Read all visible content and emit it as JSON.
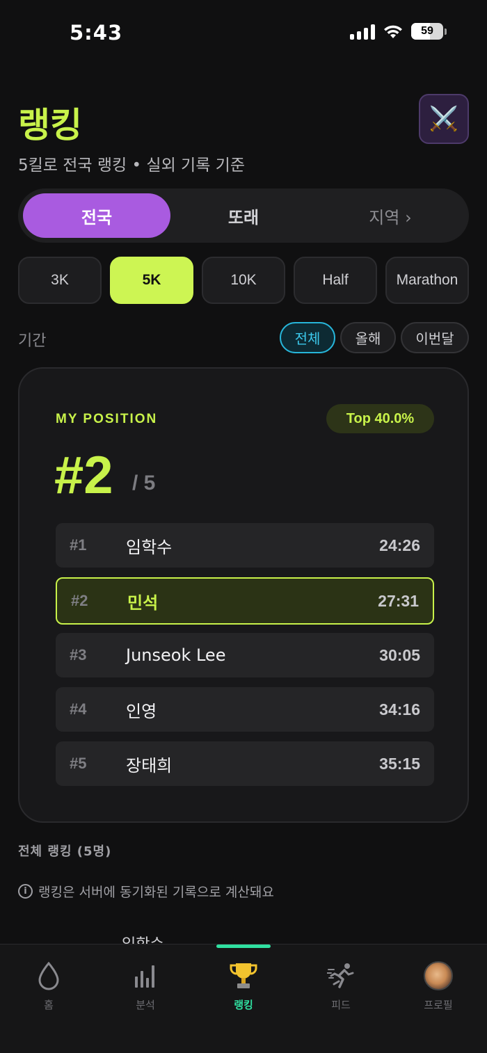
{
  "status_bar": {
    "time": "5:43",
    "battery": "59"
  },
  "header": {
    "title": "랭킹",
    "subtitle": "5킬로 전국 랭킹 • 실외 기록 기준",
    "battle_icon": "crossed-swords-icon"
  },
  "scope_tabs": [
    {
      "label": "전국",
      "active": true
    },
    {
      "label": "또래",
      "active": false
    },
    {
      "label": "지역 ›",
      "active": false
    }
  ],
  "distance_chips": [
    {
      "label": "3K",
      "active": false
    },
    {
      "label": "5K",
      "active": true
    },
    {
      "label": "10K",
      "active": false
    },
    {
      "label": "Half",
      "active": false
    },
    {
      "label": "Marathon",
      "active": false
    }
  ],
  "period": {
    "label": "기간",
    "options": [
      {
        "label": "전체",
        "active": true
      },
      {
        "label": "올해",
        "active": false
      },
      {
        "label": "이번달",
        "active": false
      }
    ]
  },
  "my_position": {
    "label": "MY POSITION",
    "top_badge": "Top 40.0%",
    "rank": "#2",
    "total": "/ 5"
  },
  "rankings": [
    {
      "rank": "#1",
      "name": "임학수",
      "time": "24:26",
      "me": false
    },
    {
      "rank": "#2",
      "name": "민석",
      "time": "27:31",
      "me": true
    },
    {
      "rank": "#3",
      "name": "Junseok Lee",
      "time": "30:05",
      "me": false
    },
    {
      "rank": "#4",
      "name": "인영",
      "time": "34:16",
      "me": false
    },
    {
      "rank": "#5",
      "name": "장태희",
      "time": "35:15",
      "me": false
    }
  ],
  "full_ranking_title": "전체 랭킹 (5명)",
  "info_text": "랭킹은 서버에 동기화된 기록으로 계산돼요",
  "peek_name": "임학수",
  "tab_bar": [
    {
      "label": "홈",
      "icon": "drop-icon",
      "active": false
    },
    {
      "label": "분석",
      "icon": "bar-chart-icon",
      "active": false
    },
    {
      "label": "랭킹",
      "icon": "trophy-icon",
      "active": true
    },
    {
      "label": "피드",
      "icon": "runner-icon",
      "active": false
    },
    {
      "label": "프로필",
      "icon": "avatar-icon",
      "active": false
    }
  ],
  "colors": {
    "accent_lime": "#c8f24a",
    "accent_purple": "#a95be0",
    "accent_cyan": "#27b5d9",
    "accent_green": "#30e0a1"
  }
}
